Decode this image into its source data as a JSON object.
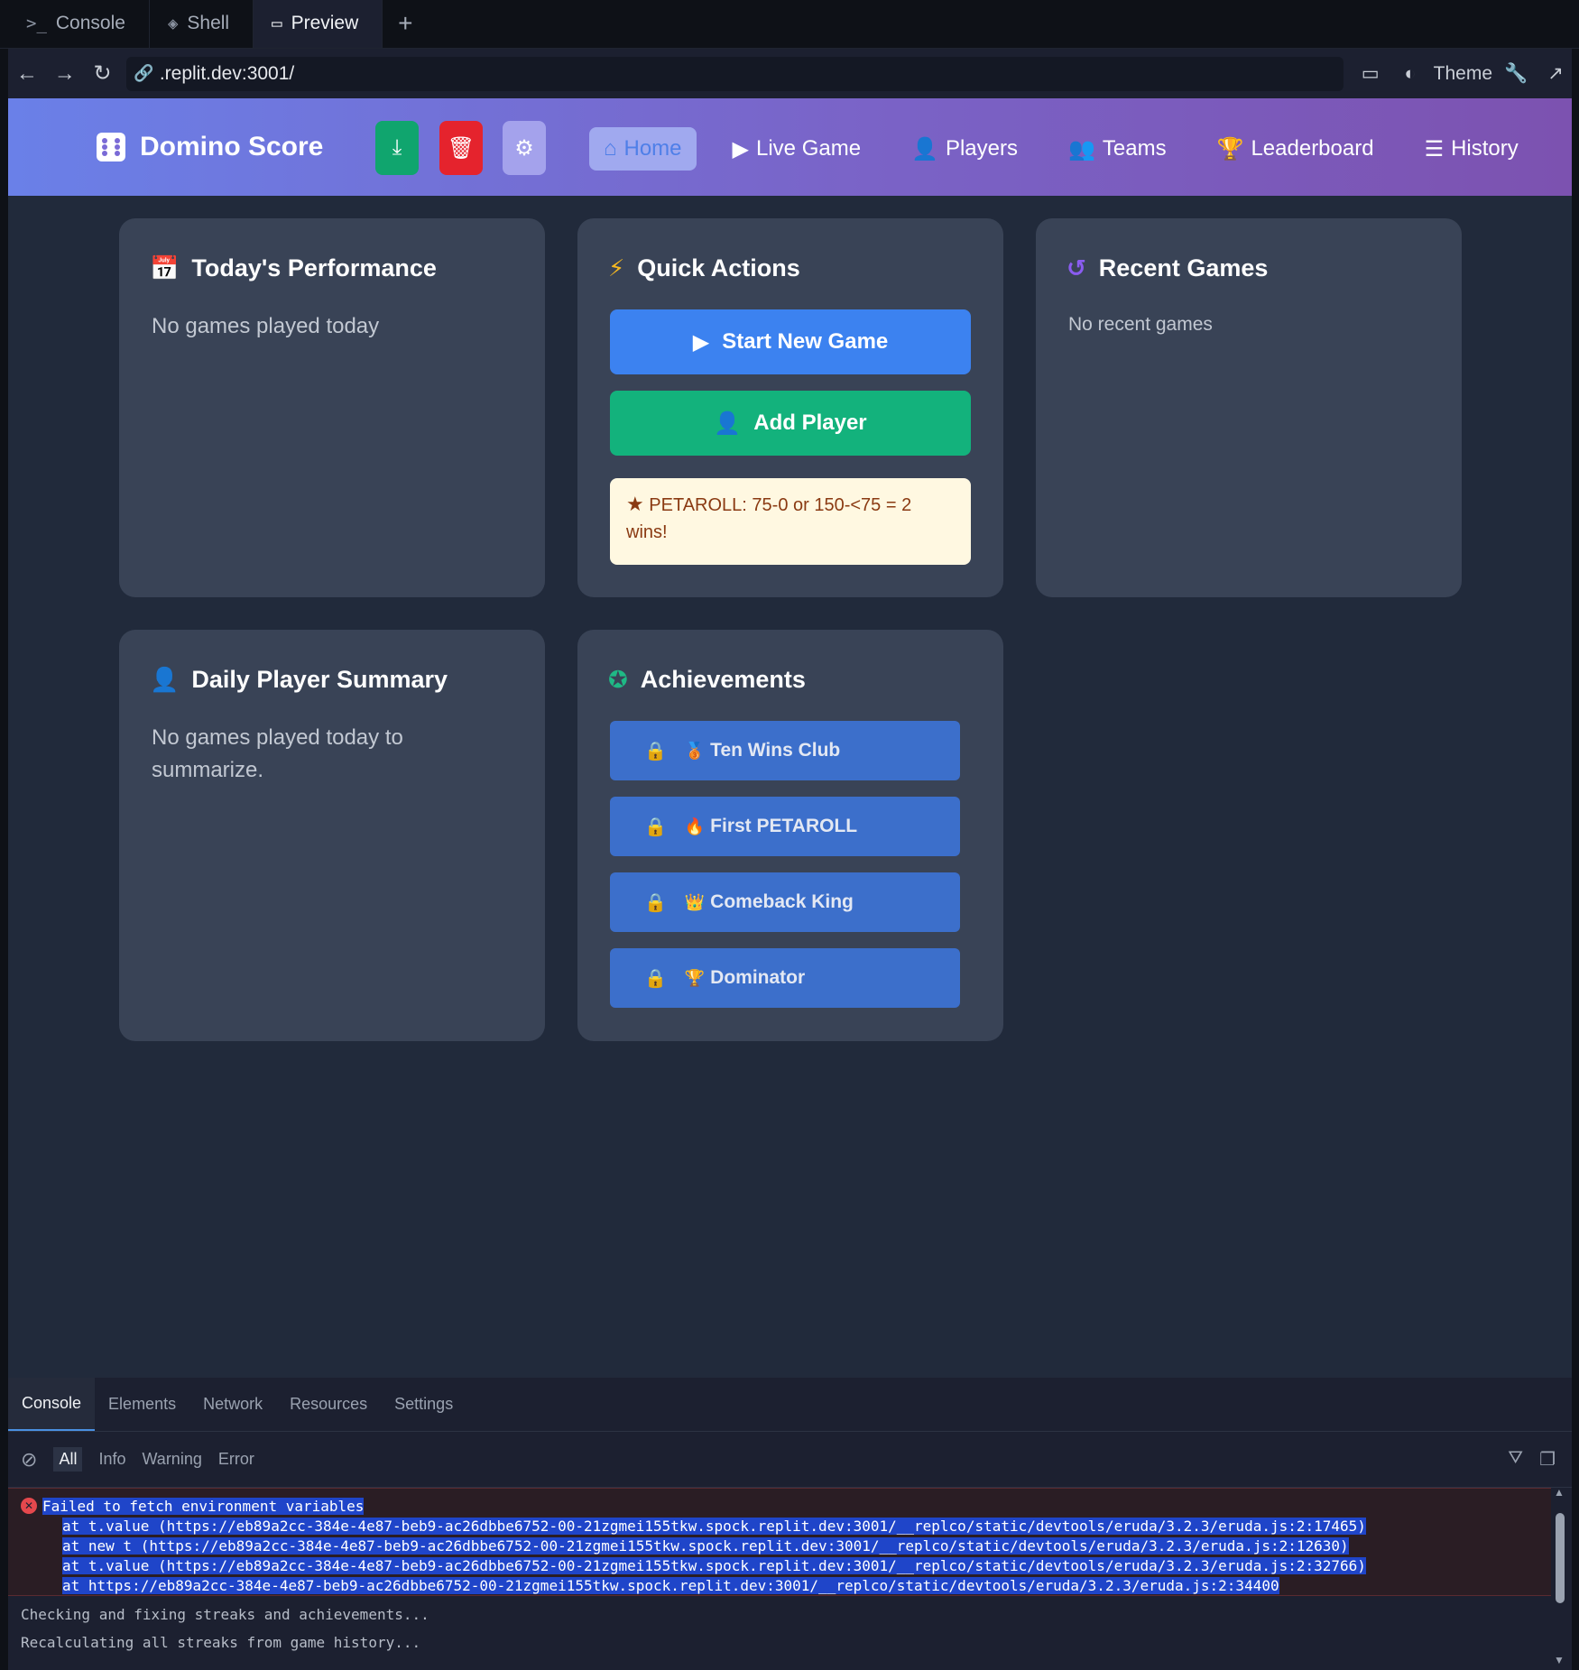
{
  "tabs": [
    {
      "icon": ">_",
      "label": "Console"
    },
    {
      "icon": "shell-icon",
      "label": "Shell"
    },
    {
      "icon": "monitor-icon",
      "label": "Preview"
    }
  ],
  "address": {
    "url": ".replit.dev:3001/",
    "theme_label": "Theme"
  },
  "app": {
    "brand": "Domino Score",
    "nav": [
      {
        "label": "Home",
        "icon": "home-icon"
      },
      {
        "label": "Live Game",
        "icon": "play-icon"
      },
      {
        "label": "Players",
        "icon": "user-plus-icon"
      },
      {
        "label": "Teams",
        "icon": "users-icon"
      },
      {
        "label": "Leaderboard",
        "icon": "trophy-icon"
      },
      {
        "label": "History",
        "icon": "list-icon"
      }
    ],
    "colors": {
      "header_start": "#6a80e8",
      "header_end": "#7c52b0",
      "card_bg": "#394356",
      "page_bg": "#212a3b",
      "primary_blue": "#3c82f0",
      "success_green": "#13b27c",
      "danger_red": "#e5232d"
    }
  },
  "cards": {
    "today": {
      "title": "Today's Performance",
      "empty": "No games played today"
    },
    "quick": {
      "title": "Quick Actions",
      "start_label": "Start New Game",
      "add_label": "Add Player",
      "petaroll_note": "PETAROLL: 75-0 or 150-<75 = 2 wins!"
    },
    "recent": {
      "title": "Recent Games",
      "empty": "No recent games"
    },
    "summary": {
      "title": "Daily Player Summary",
      "empty": "No games played today to summarize."
    },
    "achievements": {
      "title": "Achievements",
      "items": [
        {
          "emoji": "🥉",
          "label": "Ten Wins Club"
        },
        {
          "emoji": "🔥",
          "label": "First PETAROLL"
        },
        {
          "emoji": "👑",
          "label": "Comeback King"
        },
        {
          "emoji": "🏆",
          "label": "Dominator"
        }
      ]
    }
  },
  "devtools": {
    "tabs": [
      "Console",
      "Elements",
      "Network",
      "Resources",
      "Settings"
    ],
    "levels": [
      "All",
      "Info",
      "Warning",
      "Error"
    ],
    "error": {
      "message": "Failed to fetch environment variables",
      "stack": [
        "at t.value (https://eb89a2cc-384e-4e87-beb9-ac26dbbe6752-00-21zgmei155tkw.spock.replit.dev:3001/__replco/static/devtools/eruda/3.2.3/eruda.js:2:17465)",
        "at new t (https://eb89a2cc-384e-4e87-beb9-ac26dbbe6752-00-21zgmei155tkw.spock.replit.dev:3001/__replco/static/devtools/eruda/3.2.3/eruda.js:2:12630)",
        "at t.value (https://eb89a2cc-384e-4e87-beb9-ac26dbbe6752-00-21zgmei155tkw.spock.replit.dev:3001/__replco/static/devtools/eruda/3.2.3/eruda.js:2:32766)",
        "at https://eb89a2cc-384e-4e87-beb9-ac26dbbe6752-00-21zgmei155tkw.spock.replit.dev:3001/__replco/static/devtools/eruda/3.2.3/eruda.js:2:34400"
      ]
    },
    "logs": [
      "Checking and fixing streaks and achievements...",
      "Recalculating all streaks from game history..."
    ]
  }
}
